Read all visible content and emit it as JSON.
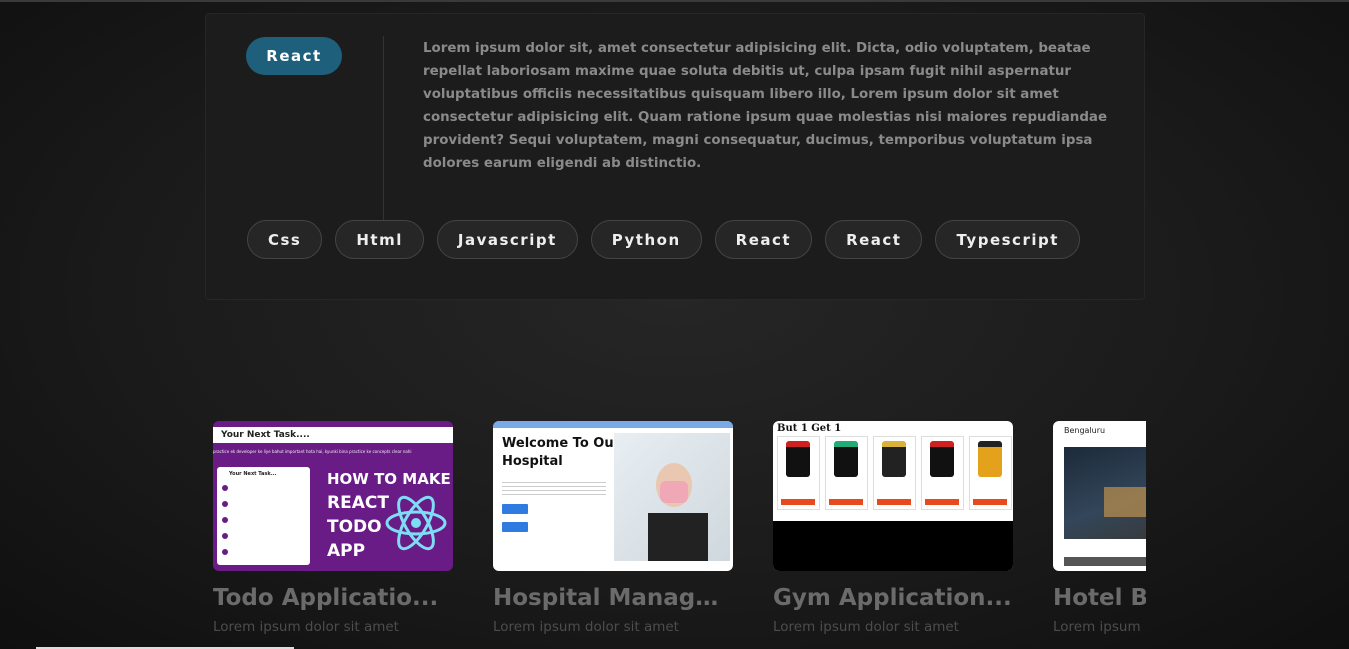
{
  "detail": {
    "main_tag": "React",
    "description": "Lorem ipsum dolor sit, amet consectetur adipisicing elit. Dicta, odio voluptatem, beatae repellat laboriosam maxime quae soluta debitis ut, culpa ipsam fugit nihil aspernatur voluptatibus officiis necessitatibus quisquam libero illo, Lorem ipsum dolor sit amet consectetur adipisicing elit. Quam ratione ipsum quae molestias nisi maiores repudiandae provident? Sequi voluptatem, magni consequatur, ducimus, temporibus voluptatum ipsa dolores earum eligendi ab distinctio.",
    "tags": [
      "Css",
      "Html",
      "Javascript",
      "Python",
      "React",
      "React",
      "Typescript"
    ]
  },
  "projects": [
    {
      "title": "Todo Applicatio...",
      "subtitle": "Lorem ipsum dolor sit amet",
      "thumb": {
        "header": "Your Next Task....",
        "caption": "practice ek developer ke liye bahut important hota hai, kyunki bina practice ke concepts clear nahi",
        "panel_title": "Your Next Task...",
        "headline": [
          "HOW TO MAKE",
          "REACT",
          "TODO",
          "APP"
        ]
      }
    },
    {
      "title": "Hospital Manage...",
      "subtitle": "Lorem ipsum dolor sit amet",
      "thumb": {
        "headline": [
          "Welcome To Our",
          "Hospital"
        ]
      }
    },
    {
      "title": "Gym Application...",
      "subtitle": "Lorem ipsum dolor sit amet",
      "thumb": {
        "headline": "But 1 Get 1"
      }
    },
    {
      "title": "Hotel Bo",
      "subtitle": "Lorem ipsum",
      "thumb": {
        "city": "Bengaluru"
      }
    }
  ],
  "colors": {
    "accent_badge": "#1e5f7c",
    "todo_purple": "#6a1c86",
    "gym_orange": "#e8491d"
  }
}
